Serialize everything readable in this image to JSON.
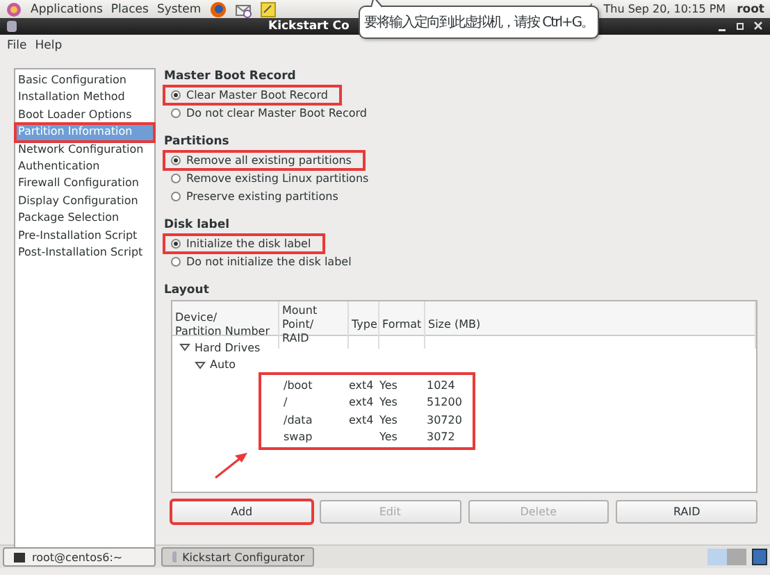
{
  "top_panel": {
    "menus": [
      "Applications",
      "Places",
      "System"
    ],
    "clock": "Thu Sep 20, 10:15 PM",
    "user": "root"
  },
  "tooltip": {
    "text": "要将输入定向到此虚拟机，请按 Ctrl+G。"
  },
  "window": {
    "title": "Kickstart Co"
  },
  "menu_bar": [
    "File",
    "Help"
  ],
  "sidebar": {
    "items": [
      {
        "label": "Basic Configuration",
        "selected": false,
        "highlighted": false
      },
      {
        "label": "Installation Method",
        "selected": false,
        "highlighted": false
      },
      {
        "label": "Boot Loader Options",
        "selected": false,
        "highlighted": false
      },
      {
        "label": "Partition Information",
        "selected": true,
        "highlighted": true
      },
      {
        "label": "Network Configuration",
        "selected": false,
        "highlighted": false
      },
      {
        "label": "Authentication",
        "selected": false,
        "highlighted": false
      },
      {
        "label": "Firewall Configuration",
        "selected": false,
        "highlighted": false
      },
      {
        "label": "Display Configuration",
        "selected": false,
        "highlighted": false
      },
      {
        "label": "Package Selection",
        "selected": false,
        "highlighted": false
      },
      {
        "label": "Pre-Installation Script",
        "selected": false,
        "highlighted": false
      },
      {
        "label": "Post-Installation Script",
        "selected": false,
        "highlighted": false
      }
    ]
  },
  "sections": [
    {
      "title": "Master Boot Record",
      "options": [
        {
          "label": "Clear Master Boot Record",
          "selected": true,
          "highlighted": true
        },
        {
          "label": "Do not clear Master Boot Record",
          "selected": false,
          "highlighted": false
        }
      ]
    },
    {
      "title": "Partitions",
      "options": [
        {
          "label": "Remove all existing partitions",
          "selected": true,
          "highlighted": true
        },
        {
          "label": "Remove existing Linux partitions",
          "selected": false,
          "highlighted": false
        },
        {
          "label": "Preserve existing partitions",
          "selected": false,
          "highlighted": false
        }
      ]
    },
    {
      "title": "Disk label",
      "options": [
        {
          "label": "Initialize the disk label",
          "selected": true,
          "highlighted": true
        },
        {
          "label": "Do not initialize the disk label",
          "selected": false,
          "highlighted": false
        }
      ]
    }
  ],
  "layout": {
    "title": "Layout",
    "columns": [
      "Device/\nPartition Number",
      "Mount Point/\nRAID",
      "Type",
      "Format",
      "Size (MB)"
    ],
    "tree": [
      {
        "label": "Hard Drives",
        "expanded": true,
        "children": [
          {
            "label": "Auto",
            "expanded": true,
            "highlighted": true,
            "partitions": [
              {
                "mount_point": "/boot",
                "type": "ext4",
                "format": "Yes",
                "size": "1024"
              },
              {
                "mount_point": "/",
                "type": "ext4",
                "format": "Yes",
                "size": "51200"
              },
              {
                "mount_point": "/data",
                "type": "ext4",
                "format": "Yes",
                "size": "30720"
              },
              {
                "mount_point": "swap",
                "format": "Yes",
                "size": "3072"
              }
            ]
          }
        ]
      }
    ],
    "annotation_arrow": true,
    "buttons": [
      {
        "label": "Add",
        "disabled": false,
        "highlighted": true
      },
      {
        "label": "Edit",
        "disabled": true,
        "highlighted": false
      },
      {
        "label": "Delete",
        "disabled": true,
        "highlighted": false
      },
      {
        "label": "RAID",
        "disabled": false,
        "highlighted": false
      }
    ]
  },
  "taskbar": {
    "items": [
      {
        "label": "root@centos6:~",
        "selected": false
      },
      {
        "label": "Kickstart Configurator",
        "selected": true
      }
    ]
  }
}
